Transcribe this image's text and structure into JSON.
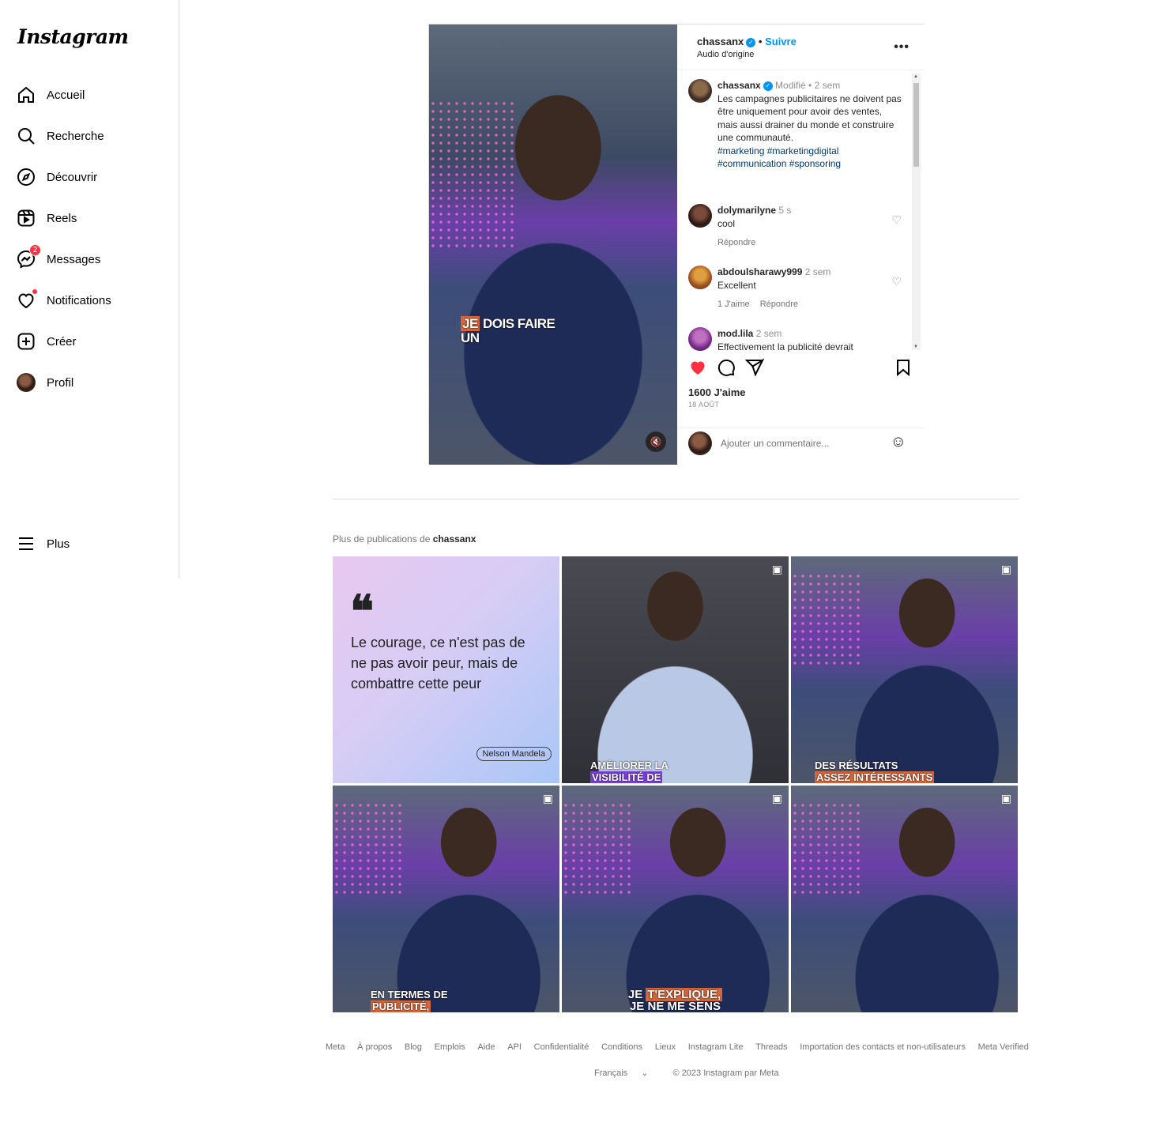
{
  "sidebar": {
    "logo": "Instagram",
    "items": [
      {
        "label": "Accueil",
        "icon": "home-icon"
      },
      {
        "label": "Recherche",
        "icon": "search-icon"
      },
      {
        "label": "Découvrir",
        "icon": "compass-icon"
      },
      {
        "label": "Reels",
        "icon": "reels-icon"
      },
      {
        "label": "Messages",
        "icon": "messenger-icon",
        "badge": "2"
      },
      {
        "label": "Notifications",
        "icon": "heart-icon"
      },
      {
        "label": "Créer",
        "icon": "plus-square-icon"
      },
      {
        "label": "Profil",
        "icon": "avatar"
      }
    ],
    "more_label": "Plus"
  },
  "post": {
    "video_caption_highlight": "JE",
    "video_caption_rest": " DOIS FAIRE",
    "video_caption_line2": "UN",
    "author": "chassanx",
    "follow_label": "Suivre",
    "audio": "Audio d'origine",
    "caption": {
      "user": "chassanx",
      "edited": "Modifié",
      "time": "2 sem",
      "text": "Les campagnes publicitaires ne doivent pas être uniquement pour avoir des ventes, mais aussi drainer du monde et construire une communauté.",
      "tags": "#marketing #marketingdigital #communication #sponsoring"
    },
    "comments": [
      {
        "user": "dolymarilyne",
        "time": "5 s",
        "text": "cool",
        "reply": "Répondre"
      },
      {
        "user": "abdoulsharawy999",
        "time": "2 sem",
        "text": "Excellent",
        "likes": "1 J'aime",
        "reply": "Répondre"
      },
      {
        "user": "mod.lila",
        "time": "2 sem",
        "text": "Effectivement la publicité devrait"
      }
    ],
    "likes": "1600 J'aime",
    "date": "18 AOÛT",
    "comment_placeholder": "Ajouter un commentaire..."
  },
  "more": {
    "title_prefix": "Plus de publications de",
    "title_user": "chassanx",
    "quote": {
      "marks": "66",
      "text": "Le courage, ce n'est pas de ne pas avoir peur, mais de combattre cette peur",
      "author": "Nelson Mandela"
    },
    "tiles": [
      {
        "cap_a": "AMÉLIORER LA",
        "cap_b": "VISIBILITÉ DE"
      },
      {
        "cap_a": "DES RÉSULTATS",
        "cap_b": "ASSEZ INTÉRESSANTS"
      },
      {
        "cap_a": "EN TERMES DE",
        "cap_b": "PUBLICITÉ,"
      },
      {
        "cap_a_hl": "JE",
        "cap_a_hl2": "T'EXPLIQUE,",
        "cap_b": "JE NE ME SENS"
      },
      {}
    ]
  },
  "footer": {
    "links": [
      "Meta",
      "À propos",
      "Blog",
      "Emplois",
      "Aide",
      "API",
      "Confidentialité",
      "Conditions",
      "Lieux",
      "Instagram Lite",
      "Threads",
      "Importation des contacts et non-utilisateurs",
      "Meta Verified"
    ],
    "language": "Français",
    "copyright": "© 2023 Instagram par Meta"
  }
}
